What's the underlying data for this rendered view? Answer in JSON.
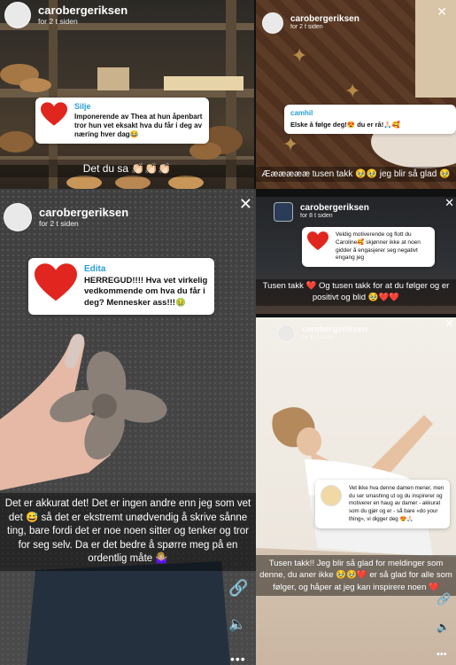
{
  "panels": {
    "p1": {
      "username": "carobergeriksen",
      "time": "for 2 t siden",
      "commenter": "Silje",
      "comment": "Imponerende av Thea at hun åpenbart tror hun vet eksakt hva du får i deg av næring hver dag😂",
      "caption": "Det du sa 👏🏻👏🏻👏🏻"
    },
    "p2": {
      "username": "carobergeriksen",
      "time": "for 2 t siden",
      "commenter": "camhil",
      "comment": "Elske å følge deg!😍 du er rå!🙏🏻🥰",
      "caption": "Ææææææ tusen takk 🥹🥹 jeg blir så glad 🥹"
    },
    "p3": {
      "username": "carobergeriksen",
      "time": "for 2 t siden",
      "commenter": "Edita",
      "comment": "HERREGUD!!!! Hva vet virkelig vedkommende om hva du får i deg? Mennesker ass!!!🤢",
      "caption": "Det er akkurat det! Det er ingen andre enn jeg som vet det 😅 så det er ekstremt unødvendig å skrive sånne ting, bare fordi det er noe noen sitter og tenker og tror for seg selv. Da er det bedre å spørre meg på en ordentlig måte 🤷🏼‍♀️"
    },
    "p4": {
      "username": "carobergeriksen",
      "time": "for 8 t siden",
      "comment": "Veldig motiverende og flott du Caroline🥰 skjønner ikke at noen gidder å engasjerer seg negativt engang jeg",
      "caption": "Tusen takk ❤️ Og tusen takk for at du følger og er positivt og blid 🥹❤️❤️"
    },
    "p5": {
      "username": "carobergeriksen",
      "time": "for 17 t siden",
      "comment": "Vet ikke hva denne damen mener, men du ser smashing ut og du inspirerer og motiverer en haug av damer - akkurat som du gjør og er - så bare «do your thing», vi digger deg 😍🙏🏻",
      "caption": "Tusen takk!! Jeg blir så glad for meldinger som denne, du aner ikke 🥹🥹❤️ er så glad for alle som følger, og håper at jeg kan inspirere noen ❤️"
    }
  },
  "icons": {
    "close": "close-icon",
    "link": "link-icon",
    "sound": "speaker-icon",
    "more": "more-icon"
  }
}
